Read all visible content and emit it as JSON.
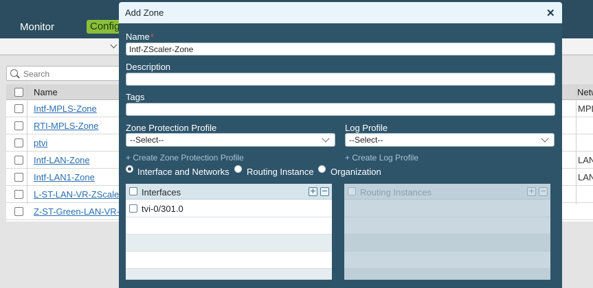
{
  "background": {
    "nav": {
      "monitor": "Monitor",
      "configuration": "Configuration"
    },
    "search_placeholder": "Search",
    "table": {
      "headers": {
        "name": "Name",
        "networks": "Networks"
      },
      "rows": [
        {
          "name": "Intf-MPLS-Zone",
          "network": "MPLS"
        },
        {
          "name": "RTI-MPLS-Zone",
          "network": ""
        },
        {
          "name": "ptvi",
          "network": ""
        },
        {
          "name": "Intf-LAN-Zone",
          "network": "LAN"
        },
        {
          "name": "Intf-LAN1-Zone",
          "network": "LAN"
        },
        {
          "name": "L-ST-LAN-VR-ZScaler",
          "network": ""
        },
        {
          "name": "Z-ST-Green-LAN-VR-ZScaler",
          "network": ""
        }
      ]
    }
  },
  "modal": {
    "title": "Add Zone",
    "close_glyph": "✕",
    "name_label": "Name",
    "required_mark": "*",
    "name_value": "Intf-ZScaler-Zone",
    "description_label": "Description",
    "description_value": "",
    "tags_label": "Tags",
    "tags_value": "",
    "zone_protection_label": "Zone Protection Profile",
    "zone_protection_value": "--Select--",
    "log_profile_label": "Log Profile",
    "log_profile_value": "--Select--",
    "create_zone_protection_link": "+ Create Zone Protection Profile",
    "create_log_profile_link": "+ Create Log Profile",
    "radio_options": [
      {
        "label": "Interface and Networks",
        "selected": true
      },
      {
        "label": "Routing Instance",
        "selected": false
      },
      {
        "label": "Organization",
        "selected": false
      }
    ],
    "interfaces_panel": {
      "title": "Interfaces",
      "add_glyph": "+",
      "remove_glyph": "−",
      "rows": [
        "tvi-0/301.0"
      ]
    },
    "routing_panel": {
      "title": "Routing Instances",
      "add_glyph": "+",
      "remove_glyph": "−",
      "rows": []
    }
  },
  "colors": {
    "modal_body": "#2e546a",
    "modal_header": "#e9f4fb",
    "top_bar": "#2b4d5f",
    "config_tab": "#8bbf3a",
    "link": "#2a6eb0"
  }
}
